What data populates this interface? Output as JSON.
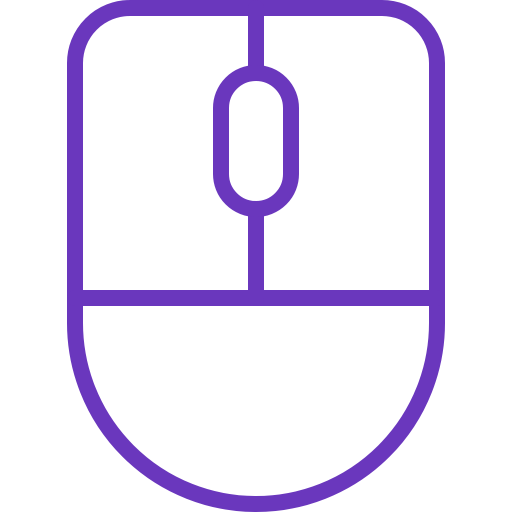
{
  "icon": {
    "name": "computer-mouse-icon",
    "stroke_color": "#6a37bd",
    "background_color": "#ffffff"
  }
}
